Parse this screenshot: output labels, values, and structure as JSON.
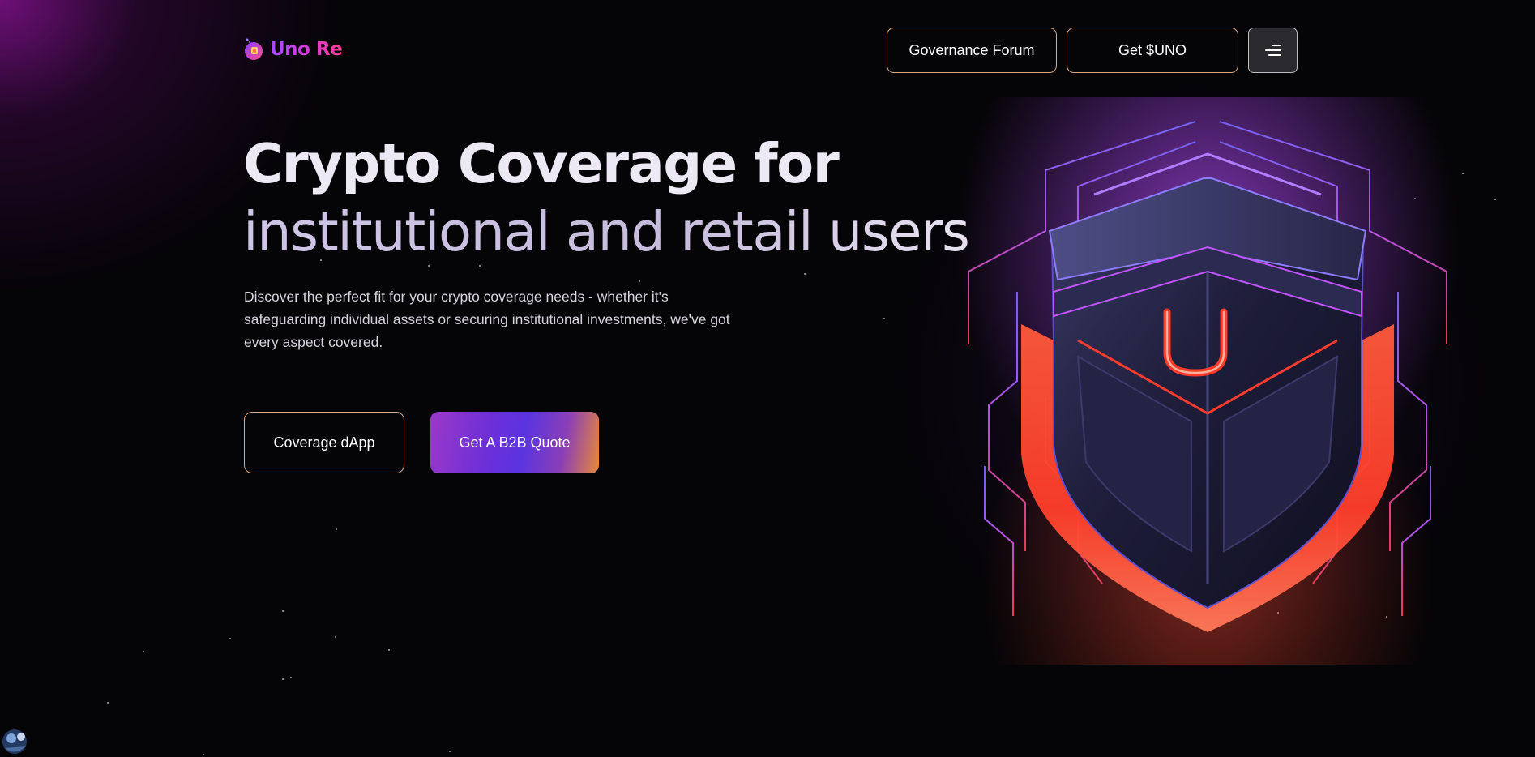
{
  "brand": {
    "name_part1": "Uno",
    "name_part2": "Re",
    "logo_icon": "uno-re-logo-icon",
    "colors": {
      "purple": "#a64bff",
      "magenta": "#d83bd6",
      "pink": "#ff3f8e",
      "outline": "#d9a989",
      "background": "#050407"
    }
  },
  "nav": {
    "governance_label": "Governance Forum",
    "get_uno_label": "Get $UNO",
    "menu_icon": "hamburger-menu-icon"
  },
  "hero": {
    "title_line1": "Crypto Coverage for",
    "title_line2": "institutional and retail users",
    "description": "Discover the perfect fit for your crypto coverage needs - whether it's safeguarding individual assets or securing institutional investments, we've got every aspect covered.",
    "primary_button": "Coverage dApp",
    "secondary_button": "Get A B2B Quote"
  },
  "illustration": {
    "icon": "shield-u-icon",
    "emblem_letter": "U"
  }
}
